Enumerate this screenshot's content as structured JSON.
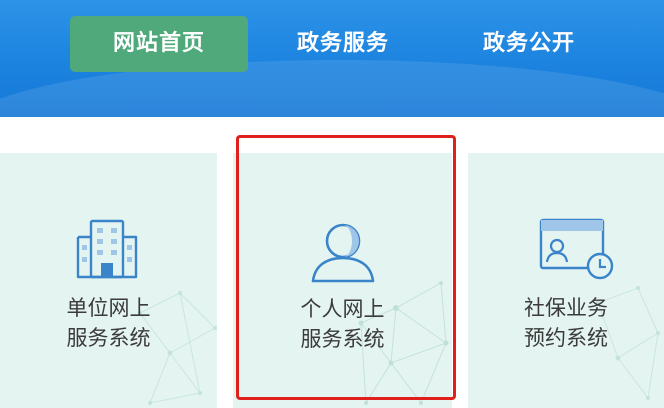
{
  "nav": {
    "items": [
      {
        "label": "网站首页",
        "active": true
      },
      {
        "label": "政务服务",
        "active": false
      },
      {
        "label": "政务公开",
        "active": false
      }
    ],
    "active_color": "#4fa97b",
    "bar_color": "#1c83df"
  },
  "cards": [
    {
      "line1": "单位网上",
      "line2": "服务系统",
      "icon": "office-building-icon"
    },
    {
      "line1": "个人网上",
      "line2": "服务系统",
      "icon": "person-user-icon",
      "highlighted": true
    },
    {
      "line1": "社保业务",
      "line2": "预约系统",
      "icon": "appointment-calendar-clock-icon"
    }
  ],
  "colors": {
    "card_bg": "#e4f4f1",
    "icon_blue": "#3a84c9",
    "highlight_red": "#e0201a"
  }
}
